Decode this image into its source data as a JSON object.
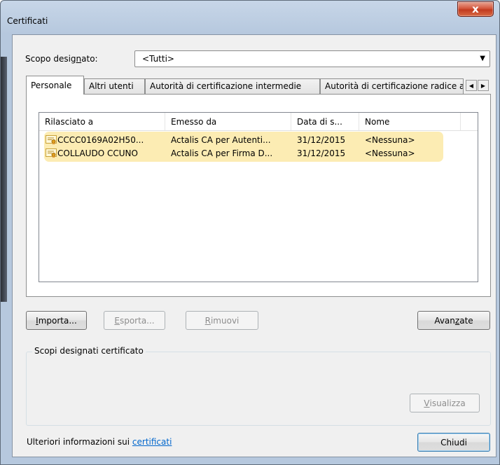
{
  "window": {
    "title": "Certificati",
    "close_glyph": "x"
  },
  "scope": {
    "label_pre": "Scopo desig",
    "label_key": "n",
    "label_post": "ato:",
    "selected": "<Tutti>"
  },
  "tabs": [
    {
      "label": "Personale"
    },
    {
      "label": "Altri utenti"
    },
    {
      "label": "Autorità di certificazione intermedie"
    },
    {
      "label": "Autorità di certificazione radice attendibili"
    }
  ],
  "table": {
    "columns": [
      "Rilasciato a",
      "Emesso da",
      "Data di s...",
      "Nome"
    ],
    "rows": [
      {
        "issued_to": "CCCC0169A02H50...",
        "issued_by": "Actalis CA per Autenti...",
        "date": "31/12/2015",
        "name": "<Nessuna>"
      },
      {
        "issued_to": "COLLAUDO CCUNO",
        "issued_by": "Actalis CA per Firma D...",
        "date": "31/12/2015",
        "name": "<Nessuna>"
      }
    ],
    "highlight_color": "#fbe9a6"
  },
  "buttons": {
    "import": {
      "key": "I",
      "rest": "mporta..."
    },
    "export": {
      "key": "E",
      "rest": "sporta..."
    },
    "remove": {
      "key": "R",
      "rest": "imuovi"
    },
    "advanced": {
      "pre": "Avan",
      "key": "z",
      "post": "ate"
    },
    "view": {
      "key": "V",
      "rest": "isualizza"
    },
    "close": "Chiudi"
  },
  "purposes_group": {
    "title": "Scopi designati certificato"
  },
  "footer": {
    "text": "Ulteriori informazioni sui ",
    "link": "certificati"
  },
  "colors": {
    "link": "#0066cc",
    "close_button": "#c13a1f",
    "client_bg": "#f0f0f0"
  }
}
